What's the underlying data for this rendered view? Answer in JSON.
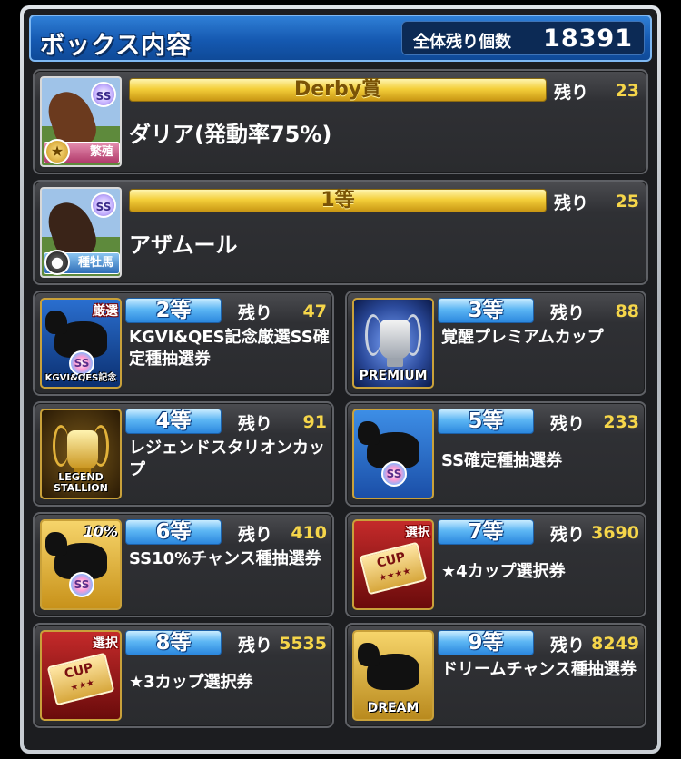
{
  "header": {
    "title": "ボックス内容",
    "remaining_label": "全体残り個数",
    "remaining_value": "18391"
  },
  "remain_label": "残り",
  "prizes_big": [
    {
      "rank": "Derby賞",
      "name": "ダリア(発動率75%)",
      "remaining": "23",
      "badge": "SS",
      "tag": "繁殖",
      "tag_icon": "★"
    },
    {
      "rank": "1等",
      "name": "アザムール",
      "remaining": "25",
      "badge": "SS",
      "tag": "種牡馬",
      "tag_icon": "●"
    }
  ],
  "prizes_small": [
    {
      "rank": "2等",
      "remaining": "47",
      "desc": "KGVI&QES記念厳選SS確定種抽選券",
      "thumb_corner": "厳選",
      "thumb_caption": "KGVI&QES記念",
      "thumb_badge": "SS"
    },
    {
      "rank": "3等",
      "remaining": "88",
      "desc": "覚醒プレミアムカップ",
      "thumb_caption": "PREMIUM"
    },
    {
      "rank": "4等",
      "remaining": "91",
      "desc": "レジェンドスタリオンカップ",
      "thumb_caption": "LEGEND STALLION"
    },
    {
      "rank": "5等",
      "remaining": "233",
      "desc": "SS確定種抽選券",
      "thumb_badge": "SS"
    },
    {
      "rank": "6等",
      "remaining": "410",
      "desc": "SS10%チャンス種抽選券",
      "thumb_corner": "10%",
      "thumb_badge": "SS"
    },
    {
      "rank": "7等",
      "remaining": "3690",
      "desc": "★4カップ選択券",
      "thumb_corner": "選択",
      "ticket_text": "CUP",
      "ticket_stars": "★★★★"
    },
    {
      "rank": "8等",
      "remaining": "5535",
      "desc": "★3カップ選択券",
      "thumb_corner": "選択",
      "ticket_text": "CUP",
      "ticket_stars": "★★★"
    },
    {
      "rank": "9等",
      "remaining": "8249",
      "desc": "ドリームチャンス種抽選券",
      "thumb_caption": "DREAM"
    }
  ]
}
